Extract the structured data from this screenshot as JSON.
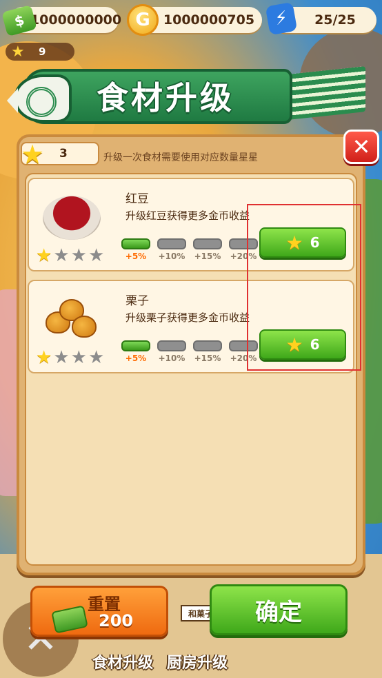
{
  "resources": {
    "cash": "1000000000",
    "coins": "1000000705",
    "energy": "25/25",
    "level": "9"
  },
  "icons": {
    "cash": "cash-stack-icon",
    "coin": "coin-icon",
    "energy": "lightning-icon",
    "star": "star-icon",
    "close": "close-icon"
  },
  "dialog": {
    "title": "食材升级",
    "star_count": "3",
    "hint": "升级一次食材需要使用对应数量星星",
    "close_symbol": "✕"
  },
  "ingredients": [
    {
      "name": "红豆",
      "description": "升级红豆获得更多金币收益",
      "stars_filled": 1,
      "stars_total": 4,
      "levels": [
        {
          "label": "+5%",
          "active": true
        },
        {
          "label": "+10%",
          "active": false
        },
        {
          "label": "+15%",
          "active": false
        },
        {
          "label": "+20%",
          "active": false
        }
      ],
      "upgrade_cost": "6"
    },
    {
      "name": "栗子",
      "description": "升级栗子获得更多金币收益",
      "stars_filled": 1,
      "stars_total": 4,
      "levels": [
        {
          "label": "+5%",
          "active": true
        },
        {
          "label": "+10%",
          "active": false
        },
        {
          "label": "+15%",
          "active": false
        },
        {
          "label": "+20%",
          "active": false
        }
      ],
      "upgrade_cost": "6"
    }
  ],
  "buttons": {
    "reset_label": "重置",
    "reset_cost": "200",
    "confirm_label": "确定"
  },
  "bottom_tabs": {
    "food_upgrade": "食材升级",
    "kitchen_upgrade": "厨房升级",
    "shop_sign": "和菓子"
  },
  "colors": {
    "banner_green": "#2b8c4e",
    "panel_orange": "#e0b272",
    "button_green": "#3fa81a",
    "button_orange": "#ef6a10",
    "close_red": "#d0201a",
    "highlight_red": "#e03030"
  }
}
